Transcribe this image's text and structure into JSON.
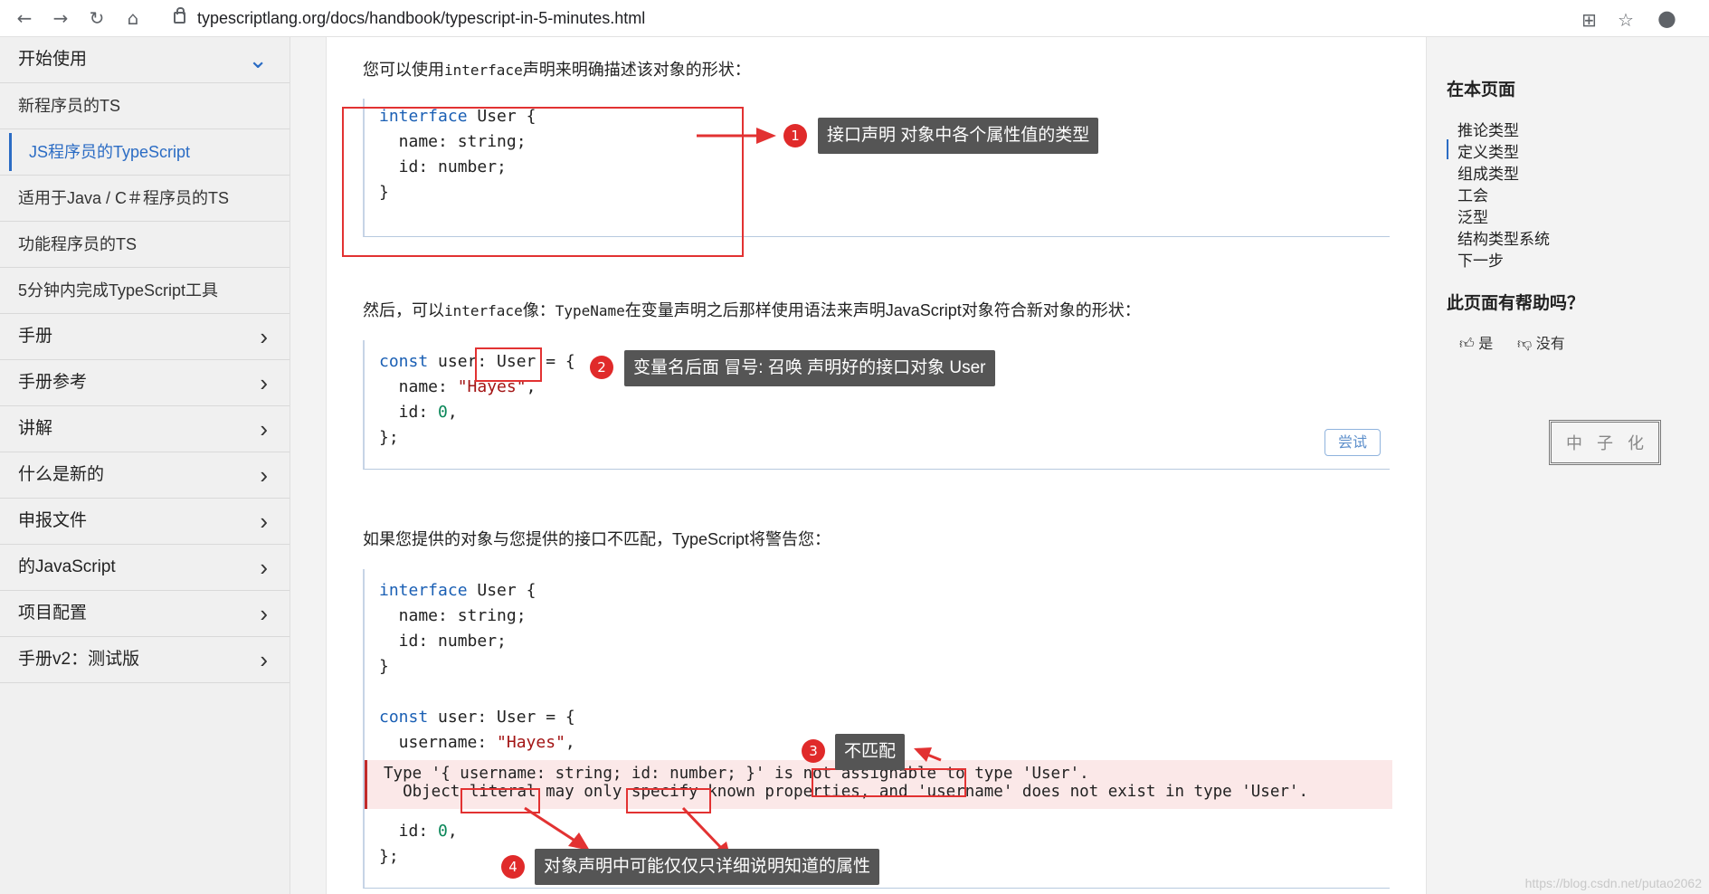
{
  "browser": {
    "url": "typescriptlang.org/docs/handbook/typescript-in-5-minutes.html"
  },
  "sidebar": {
    "items": [
      {
        "label": "开始使用",
        "type": "section-open"
      },
      {
        "label": "新程序员的TS",
        "type": "sub"
      },
      {
        "label": "JS程序员的TypeScript",
        "type": "sub-active"
      },
      {
        "label": "适用于Java / C＃程序员的TS",
        "type": "sub"
      },
      {
        "label": "功能程序员的TS",
        "type": "sub"
      },
      {
        "label": "5分钟内完成TypeScript工具",
        "type": "sub"
      },
      {
        "label": "手册",
        "type": "section"
      },
      {
        "label": "手册参考",
        "type": "section"
      },
      {
        "label": "讲解",
        "type": "section"
      },
      {
        "label": "什么是新的",
        "type": "section"
      },
      {
        "label": "申报文件",
        "type": "section"
      },
      {
        "label": "的JavaScript",
        "type": "section"
      },
      {
        "label": "项目配置",
        "type": "section"
      },
      {
        "label": "手册v2：测试版",
        "type": "section"
      }
    ]
  },
  "main": {
    "p1_a": "您可以使用",
    "p1_code": "interface",
    "p1_b": "声明来明确描述该对象的形状：",
    "p2_a": "然后，可以",
    "p2_code1": "interface",
    "p2_b": "像：",
    "p2_code2": "TypeName",
    "p2_c": "在变量声明之后那样使用语法来声明JavaScript对象符合新对象的形状：",
    "p3": "如果您提供的对象与您提供的接口不匹配，TypeScript将警告您：",
    "try_label": "尝试",
    "code1": {
      "l1a": "interface",
      "l1b": " User {",
      "l2": "  name: string;",
      "l3": "  id: number;",
      "l4": "}"
    },
    "code2": {
      "l1a": "const",
      "l1b": " user: User = {",
      "l2a": "  name: ",
      "l2b": "\"Hayes\"",
      "l2c": ",",
      "l3a": "  id: ",
      "l3b": "0",
      "l3c": ",",
      "l4": "};"
    },
    "code3": {
      "l1a": "interface",
      "l1b": " User {",
      "l2": "  name: string;",
      "l3": "  id: number;",
      "l4": "}",
      "l6a": "const",
      "l6b": " user: User = {",
      "l7a": "  username: ",
      "l7b": "\"Hayes\"",
      "l7c": ",",
      "err1": "Type '{ username: string; id: number; }' is not assignable to type 'User'.",
      "err2": "  Object literal may only specify known properties, and 'username' does not exist in type 'User'.",
      "l9a": "  id: ",
      "l9b": "0",
      "l9c": ",",
      "l10": "};"
    }
  },
  "toc": {
    "title": "在本页面",
    "items": [
      "推论类型",
      "定义类型",
      "组成类型",
      "工会",
      "泛型",
      "结构类型系统",
      "下一步"
    ],
    "helpful_title": "此页面有帮助吗？",
    "yes": "是",
    "no": "没有",
    "seal_chars": [
      "中",
      "子",
      "化"
    ]
  },
  "annotations": [
    {
      "num": "1",
      "text": "接口声明  对象中各个属性值的类型"
    },
    {
      "num": "2",
      "text": "变量名后面  冒号:   召唤 声明好的接口对象 User"
    },
    {
      "num": "3",
      "text": "不匹配"
    },
    {
      "num": "4",
      "text": "对象声明中可能仅仅只详细说明知道的属性"
    }
  ],
  "watermark": "https://blog.csdn.net/putao2062",
  "colors": {
    "accent": "#2b6cc4",
    "annotation_red": "#e23232",
    "callout_bg": "#555555"
  }
}
